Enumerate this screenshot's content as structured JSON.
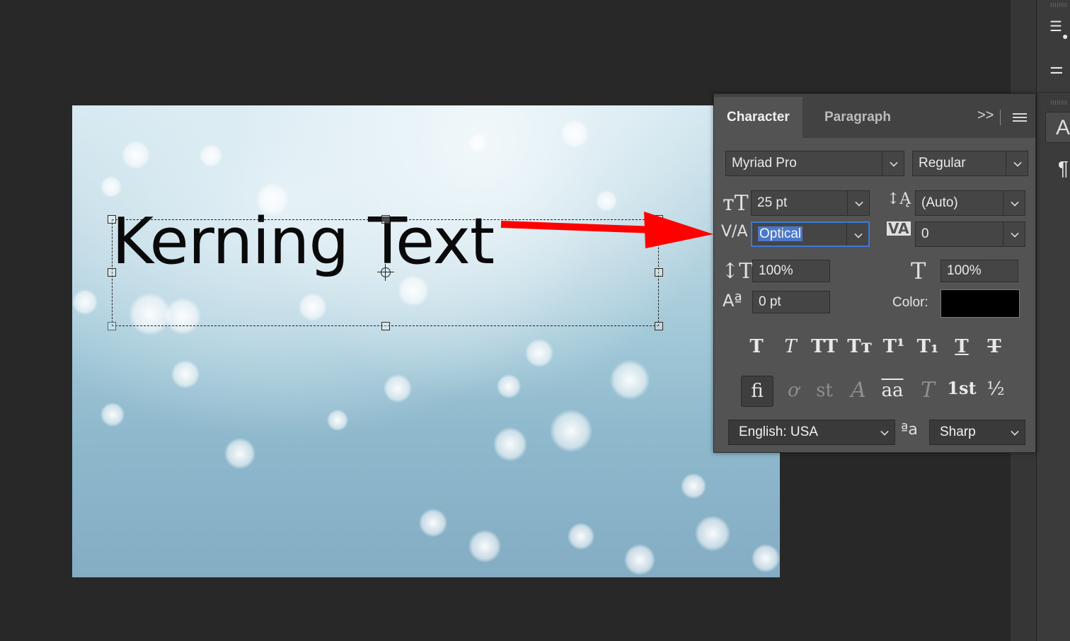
{
  "canvas": {
    "text": "Kerning Text"
  },
  "panel": {
    "tabs": [
      {
        "label": "Character"
      },
      {
        "label": "Paragraph"
      }
    ],
    "expand_glyph": ">>",
    "font_family": "Myriad Pro",
    "font_style": "Regular",
    "font_size": "25 pt",
    "leading": "(Auto)",
    "kerning": "Optical",
    "tracking": "0",
    "vertical_scale": "100%",
    "horizontal_scale": "100%",
    "baseline_shift": "0 pt",
    "color_label": "Color:",
    "text_color": "#000000",
    "style_buttons": [
      {
        "glyph": "T"
      },
      {
        "glyph": "T"
      },
      {
        "glyph": "TT"
      },
      {
        "glyph": "Tт"
      },
      {
        "glyph": "T¹"
      },
      {
        "glyph": "T₁"
      },
      {
        "glyph": "T"
      },
      {
        "glyph": "T"
      }
    ],
    "opentype_buttons": [
      {
        "glyph": "fi"
      },
      {
        "glyph": "ơ"
      },
      {
        "glyph": "st"
      },
      {
        "glyph": "A"
      },
      {
        "glyph": "aa"
      },
      {
        "glyph": "T"
      },
      {
        "glyph": "1st"
      },
      {
        "glyph": "½"
      }
    ],
    "language": "English: USA",
    "antialias_icon": "ªa",
    "antialias": "Sharp"
  },
  "dock": {
    "button_glyph": "A",
    "paragraph_glyph": "¶"
  },
  "colors": {
    "arrow": "#ff0000",
    "focus": "#3d7ad6",
    "panel_bg": "#535353"
  }
}
